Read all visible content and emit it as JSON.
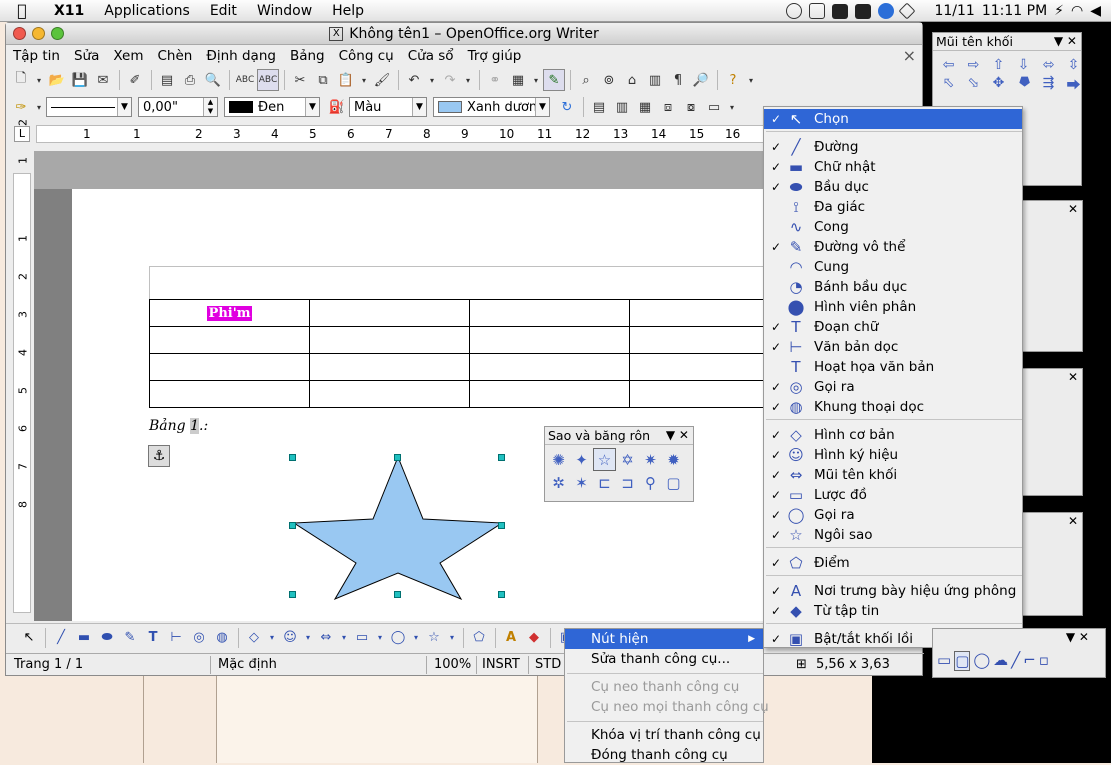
{
  "macbar": {
    "app": "X11",
    "menus": [
      "Applications",
      "Edit",
      "Window",
      "Help"
    ],
    "clock_date": "11/11",
    "clock_time": "11:11 PM"
  },
  "window": {
    "title": "Không tên1 – OpenOffice.org Writer",
    "menus": [
      "Tập tin",
      "Sửa",
      "Xem",
      "Chèn",
      "Định dạng",
      "Bảng",
      "Công cụ",
      "Cửa sổ",
      "Trợ giúp"
    ],
    "close_glyph": "×"
  },
  "format_bar": {
    "line_width": "0,00\"",
    "line_color_label": "Đen",
    "area_style": "Màu",
    "area_color_label": "Xanh dương",
    "line_color": "#000000",
    "area_color": "#99c8f2"
  },
  "ruler": {
    "h_ticks": [
      "1",
      "1",
      "2",
      "3",
      "4",
      "5",
      "6",
      "7",
      "8",
      "9",
      "10",
      "11",
      "12",
      "13",
      "14",
      "15",
      "16"
    ],
    "v_ticks": [
      "2",
      "1",
      "1",
      "2",
      "3",
      "4",
      "5",
      "6",
      "7",
      "8"
    ]
  },
  "document": {
    "cell_text": "Phi'm",
    "caption_prefix": "Bảng ",
    "caption_num": "1",
    "caption_suffix": ".:",
    "star_fill": "#99c8f2"
  },
  "star_palette": {
    "title": "Sao và băng rôn"
  },
  "top_right_palette": {
    "title": "Mũi tên khối"
  },
  "statusbar": {
    "page": "Trang 1 / 1",
    "style": "Mặc định",
    "zoom": "100%",
    "insert_mode": "INSRT",
    "selection_mode": "STD",
    "size": "5,56 x 3,63"
  },
  "context_menu": {
    "items": [
      {
        "label": "Nút hiện",
        "state": "selected",
        "submenu": "▶"
      },
      {
        "label": "Sửa thanh công cụ...",
        "state": "normal"
      },
      {
        "label": "Cụ neo thanh công cụ",
        "state": "disabled"
      },
      {
        "label": "Cụ neo mọi thanh công cụ",
        "state": "disabled"
      },
      {
        "label": "Khóa vị trí thanh công cụ",
        "state": "normal"
      },
      {
        "label": "Đóng thanh công cụ",
        "state": "normal"
      }
    ]
  },
  "submenu": {
    "check_glyph": "✓",
    "items": [
      {
        "label": "Chọn",
        "checked": true,
        "icon": "↖",
        "selected": true
      },
      {
        "label": "Đường",
        "checked": true,
        "icon": "╱"
      },
      {
        "label": "Chữ nhật",
        "checked": true,
        "icon": "▬"
      },
      {
        "label": "Bầu dục",
        "checked": true,
        "icon": "⬬"
      },
      {
        "label": "Đa giác",
        "checked": false,
        "icon": "⟟"
      },
      {
        "label": "Cong",
        "checked": false,
        "icon": "∿"
      },
      {
        "label": "Đường vô thể",
        "checked": true,
        "icon": "✎"
      },
      {
        "label": "Cung",
        "checked": false,
        "icon": "◠"
      },
      {
        "label": "Bánh bầu dục",
        "checked": false,
        "icon": "◔"
      },
      {
        "label": "Hình viên phân",
        "checked": false,
        "icon": "⬤"
      },
      {
        "label": "Đoạn chữ",
        "checked": true,
        "icon": "T"
      },
      {
        "label": "Văn bản dọc",
        "checked": true,
        "icon": "⊢"
      },
      {
        "label": "Hoạt họa văn bản",
        "checked": false,
        "icon": "T"
      },
      {
        "label": "Gọi ra",
        "checked": true,
        "icon": "◎"
      },
      {
        "label": "Khung thoại dọc",
        "checked": true,
        "icon": "◍"
      },
      {
        "label": "Hình cơ bản",
        "checked": true,
        "icon": "◇"
      },
      {
        "label": "Hình ký hiệu",
        "checked": true,
        "icon": "☺"
      },
      {
        "label": "Mũi tên khối",
        "checked": true,
        "icon": "⇔"
      },
      {
        "label": "Lược đồ",
        "checked": true,
        "icon": "▭"
      },
      {
        "label": "Gọi ra",
        "checked": true,
        "icon": "◯"
      },
      {
        "label": "Ngôi sao",
        "checked": true,
        "icon": "☆"
      },
      {
        "label": "Điểm",
        "checked": true,
        "icon": "⬠"
      },
      {
        "label": "Nơi trưng bày hiệu ứng phông",
        "checked": true,
        "icon": "A"
      },
      {
        "label": "Từ tập tin",
        "checked": true,
        "icon": "◆"
      },
      {
        "label": "Bật/tắt khối lồi",
        "checked": true,
        "icon": "▣"
      }
    ]
  }
}
